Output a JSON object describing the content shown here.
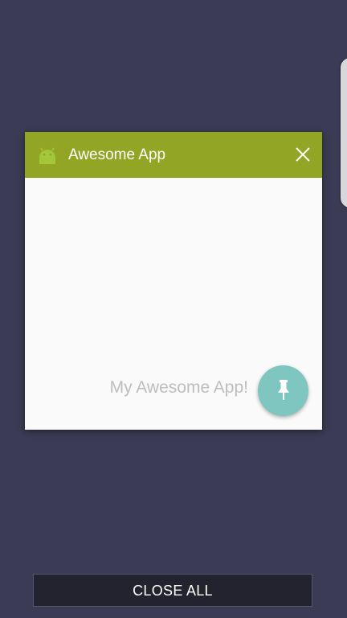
{
  "recent_card": {
    "app_icon": "android-icon",
    "app_title": "Awesome App",
    "close_icon": "close-icon",
    "content_text": "My Awesome App!",
    "pin_icon": "pin-icon",
    "header_color": "#93a524",
    "pin_color": "#7ec6bf"
  },
  "footer": {
    "close_all_label": "CLOSE ALL"
  },
  "colors": {
    "background": "#3b3b55",
    "close_all_background": "#22232f"
  }
}
